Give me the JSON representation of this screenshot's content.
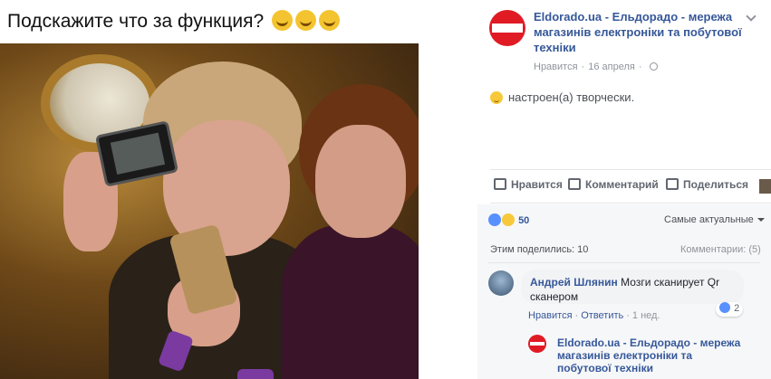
{
  "post_image": {
    "caption": "Подскажите что за функция?"
  },
  "header": {
    "page_title": "Eldorado.ua - Ельдорадо - мережа магазинів електроніки та побутової техніки",
    "liked_label": "Нравится",
    "date": "16 апреля"
  },
  "feeling": {
    "text": "настроен(а) творчески."
  },
  "actions": {
    "like_label": "Нравится",
    "comment_label": "Комментарий",
    "share_label": "Поделиться"
  },
  "reactions": {
    "count": "50",
    "sort_label": "Самые актуальные"
  },
  "stats": {
    "shares_text": "Этим поделились: 10",
    "comments_text": "Комментарии: (5)"
  },
  "comment": {
    "author": "Андрей Шлянин",
    "text": "Мозги сканирует Qr сканером",
    "reaction_count": "2",
    "like_label": "Нравится",
    "reply_label": "Ответить",
    "time": "1 нед."
  },
  "reply": {
    "author": "Eldorado.ua - Ельдорадо - мережа магазинів електроніки та побутової техніки"
  },
  "colors": {
    "link": "#365899",
    "brand_red": "#e01b24",
    "muted": "#90949c"
  }
}
